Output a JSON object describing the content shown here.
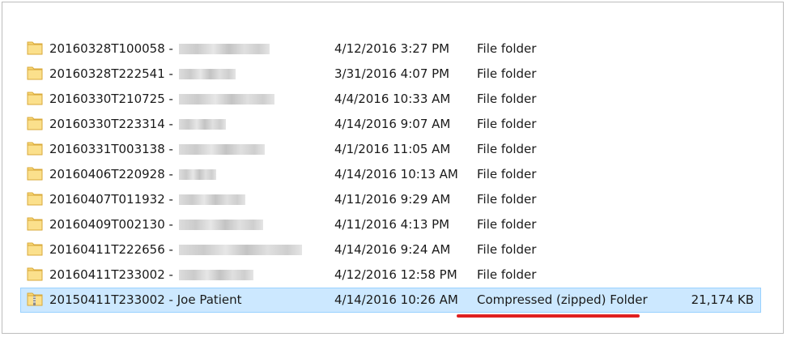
{
  "files": [
    {
      "name": "20160328T100058 -",
      "modified": "4/12/2016 3:27 PM",
      "type": "File folder",
      "size": "",
      "icon": "folder-icon"
    },
    {
      "name": "20160328T222541 -",
      "modified": "3/31/2016 4:07 PM",
      "type": "File folder",
      "size": "",
      "icon": "folder-icon"
    },
    {
      "name": "20160330T210725 -",
      "modified": "4/4/2016 10:33 AM",
      "type": "File folder",
      "size": "",
      "icon": "folder-icon"
    },
    {
      "name": "20160330T223314 -",
      "modified": "4/14/2016 9:07 AM",
      "type": "File folder",
      "size": "",
      "icon": "folder-icon"
    },
    {
      "name": "20160331T003138 -",
      "modified": "4/1/2016 11:05 AM",
      "type": "File folder",
      "size": "",
      "icon": "folder-icon"
    },
    {
      "name": "20160406T220928 -",
      "modified": "4/14/2016 10:13 AM",
      "type": "File folder",
      "size": "",
      "icon": "folder-icon"
    },
    {
      "name": "20160407T011932 -",
      "modified": "4/11/2016 9:29 AM",
      "type": "File folder",
      "size": "",
      "icon": "folder-icon"
    },
    {
      "name": "20160409T002130 -",
      "modified": "4/11/2016 4:13 PM",
      "type": "File folder",
      "size": "",
      "icon": "folder-icon"
    },
    {
      "name": "20160411T222656 -",
      "modified": "4/14/2016 9:24 AM",
      "type": "File folder",
      "size": "",
      "icon": "folder-icon"
    },
    {
      "name": "20160411T233002 -",
      "modified": "4/12/2016 12:58 PM",
      "type": "File folder",
      "size": "",
      "icon": "folder-icon"
    },
    {
      "name": "20150411T233002 - Joe Patient",
      "modified": "4/14/2016 10:26 AM",
      "type": "Compressed (zipped) Folder",
      "size": "21,174 KB",
      "icon": "zip-folder-icon",
      "selected": true
    }
  ],
  "colors": {
    "selection_bg": "#cce8ff",
    "selection_border": "#99d1ff",
    "folder_yellow": "#f8d775",
    "annotation_red": "#e02020"
  }
}
